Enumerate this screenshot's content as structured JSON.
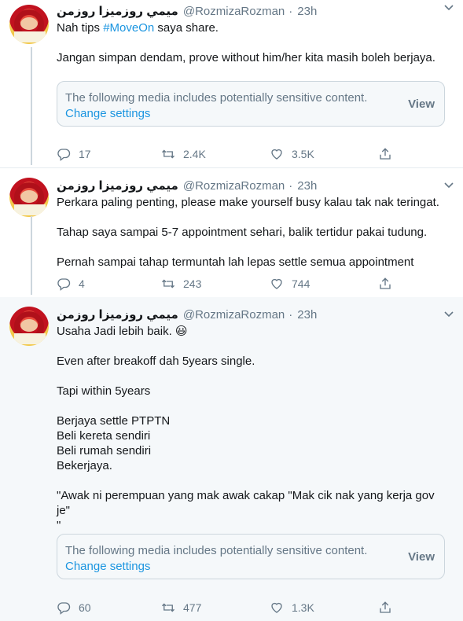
{
  "tweets": [
    {
      "display_name": "ميمي روزميزا روزمن",
      "handle": "@RozmizaRozman",
      "dot": "·",
      "time": "23h",
      "text_line1_prefix": "Nah tips ",
      "hashtag": "#MoveOn",
      "text_line1_suffix": " saya share.",
      "text_line2": "Jangan simpan dendam, prove without him/her kita masih boleh berjaya.",
      "media_notice": {
        "warning": "The following media includes potentially sensitive content.",
        "change_settings": "Change settings",
        "view": "View"
      },
      "replies": "17",
      "retweets": "2.4K",
      "likes": "3.5K"
    },
    {
      "display_name": "ميمي روزميزا روزمن",
      "handle": "@RozmizaRozman",
      "dot": "·",
      "time": "23h",
      "lines": [
        "Perkara paling penting, please make yourself busy kalau tak nak teringat.",
        "Tahap saya sampai 5-7 appointment sehari, balik tertidur pakai tudung.",
        "Pernah sampai tahap termuntah lah lepas settle semua appointment"
      ],
      "replies": "4",
      "retweets": "243",
      "likes": "744"
    },
    {
      "display_name": "ميمي روزميزا روزمن",
      "handle": "@RozmizaRozman",
      "dot": "·",
      "time": "23h",
      "lines": [
        "Usaha Jadi lebih baik. 😃",
        "Even after breakoff dah 5years single.",
        "Tapi within 5years",
        "Berjaya settle PTPTN",
        "Beli kereta sendiri",
        "Beli rumah sendiri",
        "Bekerjaya.",
        "\"Awak ni perempuan yang mak awak cakap \"Mak cik nak yang kerja gov je\"",
        "\""
      ],
      "media_notice": {
        "warning": "The following media includes potentially sensitive content.",
        "change_settings": "Change settings",
        "view": "View"
      },
      "replies": "60",
      "retweets": "477",
      "likes": "1.3K"
    }
  ],
  "icons": {
    "reply": "reply-icon",
    "retweet": "retweet-icon",
    "like": "heart-icon",
    "share": "share-icon",
    "menu": "chevron-down-icon"
  },
  "colors": {
    "link": "#1b95e0",
    "muted": "#657786",
    "border": "#ccd6dd",
    "focused_bg": "#f5f8fa"
  }
}
